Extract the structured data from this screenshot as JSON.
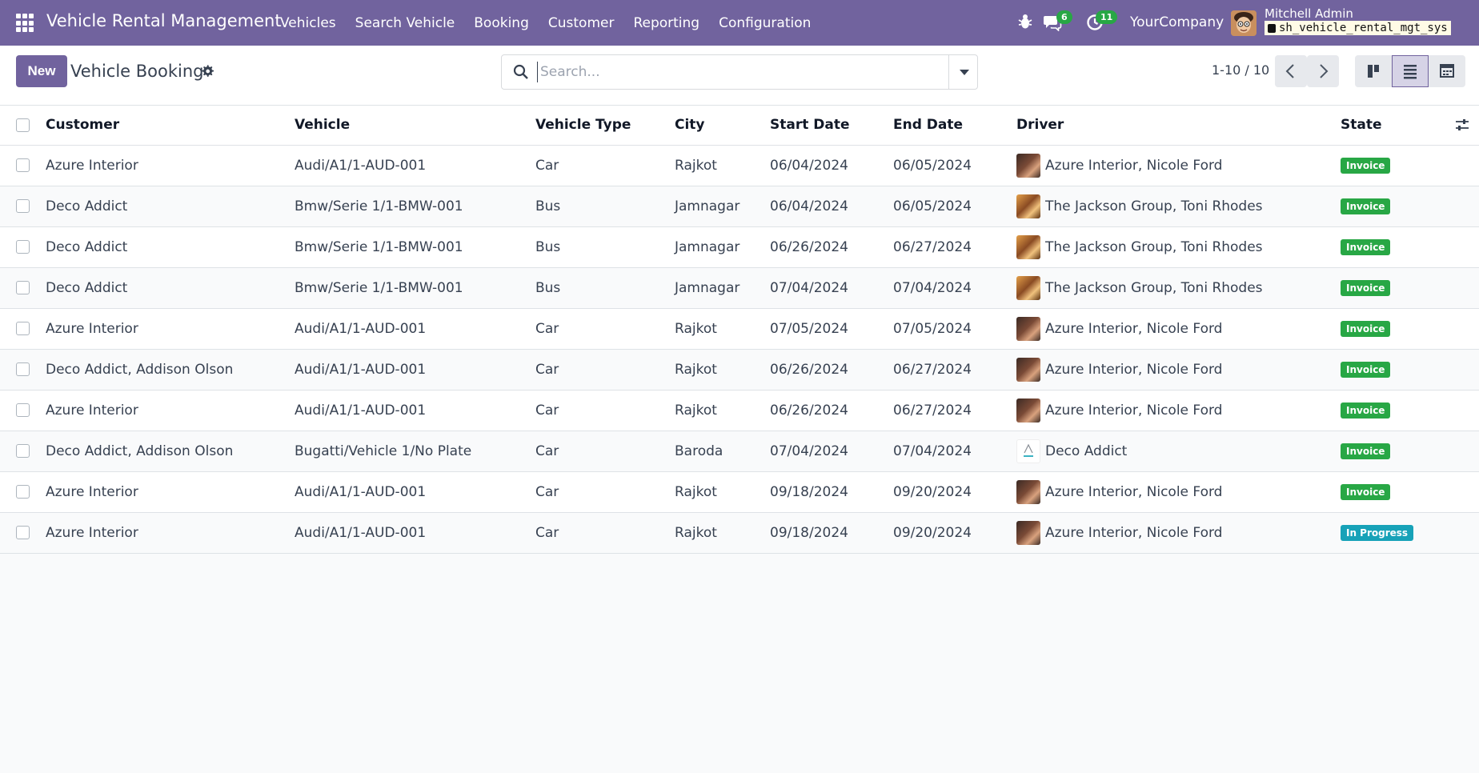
{
  "topbar": {
    "app_title": "Vehicle Rental Management",
    "menu": [
      "Vehicles",
      "Search Vehicle",
      "Booking",
      "Customer",
      "Reporting",
      "Configuration"
    ],
    "messages_count": "6",
    "activities_count": "11",
    "company": "YourCompany",
    "user_name": "Mitchell Admin",
    "db_name": "sh_vehicle_rental_mgt_sys"
  },
  "control": {
    "new_label": "New",
    "title": "Vehicle Booking",
    "search_placeholder": "Search...",
    "pager": "1-10 / 10"
  },
  "table": {
    "headers": {
      "customer": "Customer",
      "vehicle": "Vehicle",
      "vehicle_type": "Vehicle Type",
      "city": "City",
      "start_date": "Start Date",
      "end_date": "End Date",
      "driver": "Driver",
      "state": "State"
    },
    "rows": [
      {
        "customer": "Azure Interior",
        "vehicle": "Audi/A1/1-AUD-001",
        "type": "Car",
        "city": "Rajkot",
        "start": "06/04/2024",
        "end": "06/05/2024",
        "driver": "Azure Interior, Nicole Ford",
        "avatar": "nicole",
        "state": "Invoice",
        "state_kind": "invoice"
      },
      {
        "customer": "Deco Addict",
        "vehicle": "Bmw/Serie 1/1-BMW-001",
        "type": "Bus",
        "city": "Jamnagar",
        "start": "06/04/2024",
        "end": "06/05/2024",
        "driver": "The Jackson Group, Toni Rhodes",
        "avatar": "toni",
        "state": "Invoice",
        "state_kind": "invoice"
      },
      {
        "customer": "Deco Addict",
        "vehicle": "Bmw/Serie 1/1-BMW-001",
        "type": "Bus",
        "city": "Jamnagar",
        "start": "06/26/2024",
        "end": "06/27/2024",
        "driver": "The Jackson Group, Toni Rhodes",
        "avatar": "toni",
        "state": "Invoice",
        "state_kind": "invoice"
      },
      {
        "customer": "Deco Addict",
        "vehicle": "Bmw/Serie 1/1-BMW-001",
        "type": "Bus",
        "city": "Jamnagar",
        "start": "07/04/2024",
        "end": "07/04/2024",
        "driver": "The Jackson Group, Toni Rhodes",
        "avatar": "toni",
        "state": "Invoice",
        "state_kind": "invoice"
      },
      {
        "customer": "Azure Interior",
        "vehicle": "Audi/A1/1-AUD-001",
        "type": "Car",
        "city": "Rajkot",
        "start": "07/05/2024",
        "end": "07/05/2024",
        "driver": "Azure Interior, Nicole Ford",
        "avatar": "nicole",
        "state": "Invoice",
        "state_kind": "invoice"
      },
      {
        "customer": "Deco Addict, Addison Olson",
        "vehicle": "Audi/A1/1-AUD-001",
        "type": "Car",
        "city": "Rajkot",
        "start": "06/26/2024",
        "end": "06/27/2024",
        "driver": "Azure Interior, Nicole Ford",
        "avatar": "nicole",
        "state": "Invoice",
        "state_kind": "invoice"
      },
      {
        "customer": "Azure Interior",
        "vehicle": "Audi/A1/1-AUD-001",
        "type": "Car",
        "city": "Rajkot",
        "start": "06/26/2024",
        "end": "06/27/2024",
        "driver": "Azure Interior, Nicole Ford",
        "avatar": "nicole",
        "state": "Invoice",
        "state_kind": "invoice"
      },
      {
        "customer": "Deco Addict, Addison Olson",
        "vehicle": "Bugatti/Vehicle 1/No Plate",
        "type": "Car",
        "city": "Baroda",
        "start": "07/04/2024",
        "end": "07/04/2024",
        "driver": "Deco Addict",
        "avatar": "deco",
        "state": "Invoice",
        "state_kind": "invoice"
      },
      {
        "customer": "Azure Interior",
        "vehicle": "Audi/A1/1-AUD-001",
        "type": "Car",
        "city": "Rajkot",
        "start": "09/18/2024",
        "end": "09/20/2024",
        "driver": "Azure Interior, Nicole Ford",
        "avatar": "nicole",
        "state": "Invoice",
        "state_kind": "invoice"
      },
      {
        "customer": "Azure Interior",
        "vehicle": "Audi/A1/1-AUD-001",
        "type": "Car",
        "city": "Rajkot",
        "start": "09/18/2024",
        "end": "09/20/2024",
        "driver": "Azure Interior, Nicole Ford",
        "avatar": "nicole",
        "state": "In Progress",
        "state_kind": "progress"
      }
    ]
  },
  "colors": {
    "brand": "#71639e",
    "invoice": "#28a745",
    "in_progress": "#17a2b8"
  }
}
